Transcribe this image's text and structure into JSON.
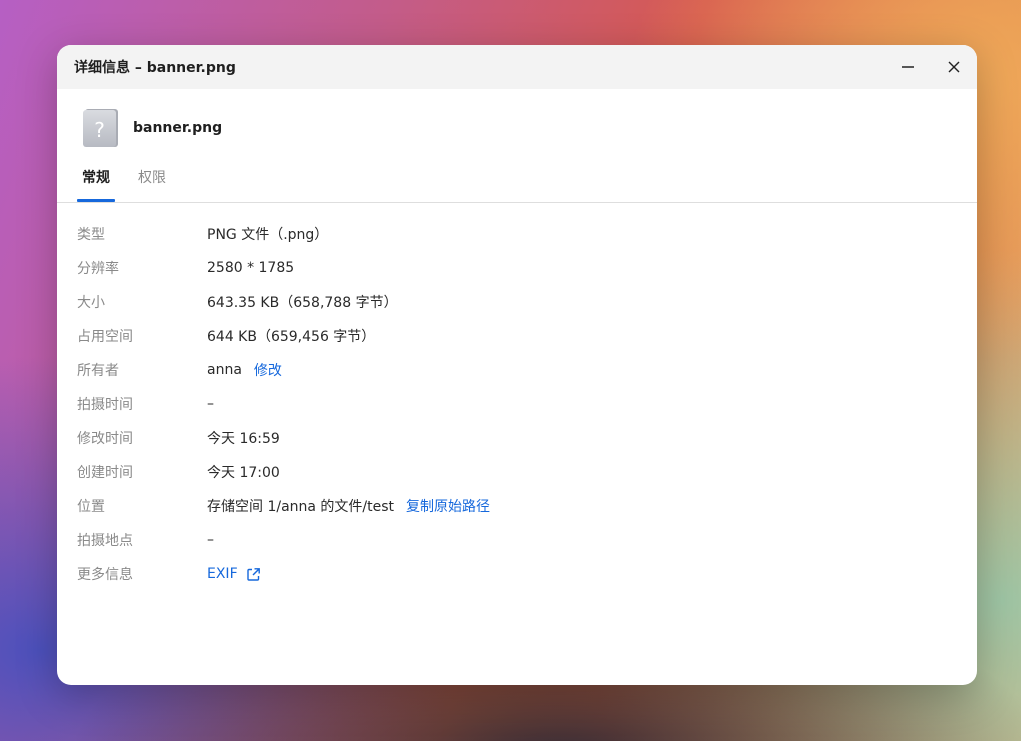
{
  "window": {
    "title": "详细信息 – banner.png",
    "minimize_icon": "minimize-icon",
    "close_icon": "close-icon"
  },
  "file": {
    "name": "banner.png",
    "icon": "unknown-file-icon"
  },
  "tabs": [
    {
      "label": "常规",
      "active": true
    },
    {
      "label": "权限",
      "active": false
    }
  ],
  "properties": {
    "type": {
      "label": "类型",
      "value": "PNG 文件（.png）"
    },
    "resolution": {
      "label": "分辨率",
      "value": "2580 * 1785"
    },
    "size": {
      "label": "大小",
      "value": "643.35 KB（658,788 字节）"
    },
    "disk_size": {
      "label": "占用空间",
      "value": "644 KB（659,456 字节）"
    },
    "owner": {
      "label": "所有者",
      "value": "anna",
      "action": "修改"
    },
    "shot_time": {
      "label": "拍摄时间",
      "value": "–"
    },
    "modified": {
      "label": "修改时间",
      "value": "今天 16:59"
    },
    "created": {
      "label": "创建时间",
      "value": "今天 17:00"
    },
    "location": {
      "label": "位置",
      "value": "存储空间 1/anna 的文件/test",
      "action": "复制原始路径"
    },
    "shot_place": {
      "label": "拍摄地点",
      "value": "–"
    },
    "more": {
      "label": "更多信息",
      "action": "EXIF",
      "icon": "external-link-icon"
    }
  },
  "colors": {
    "accent": "#1668dc",
    "label": "#8a8a8a",
    "titlebar": "#f3f3f3"
  }
}
